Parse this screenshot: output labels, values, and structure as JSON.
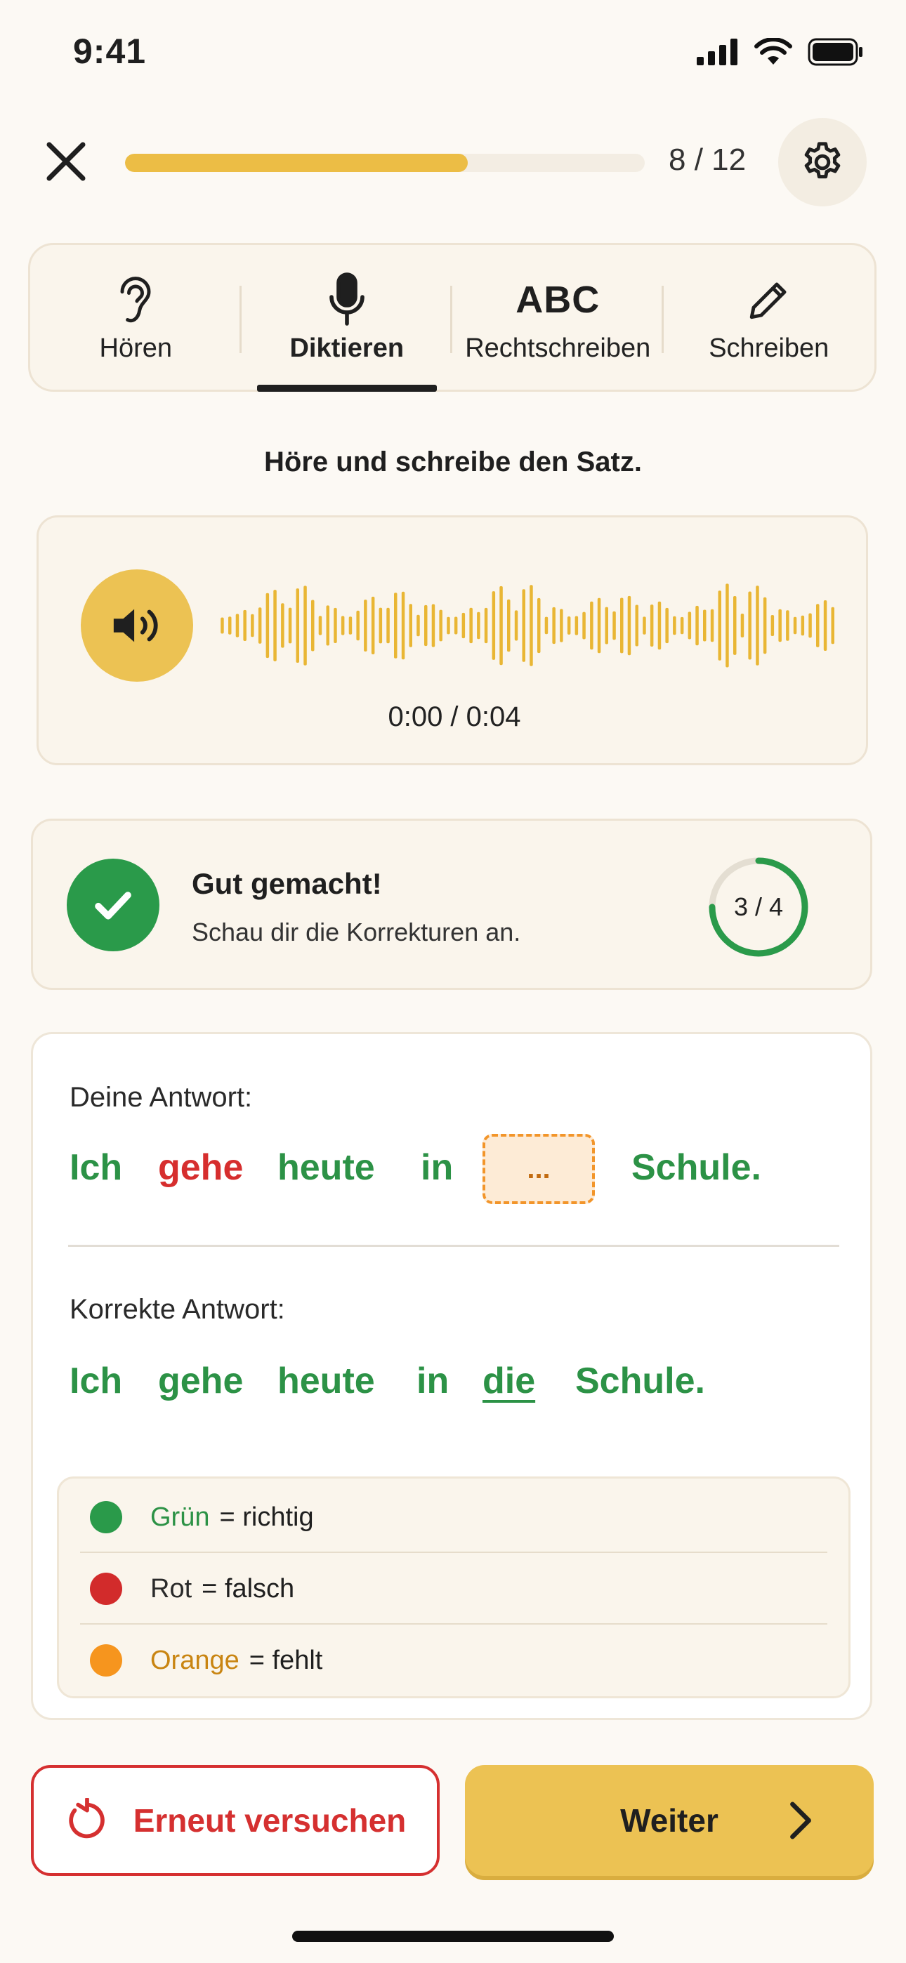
{
  "status_bar": {
    "time": "9:41"
  },
  "header": {
    "progress_text": "8 / 12",
    "progress_fraction": 0.66
  },
  "tabs": [
    {
      "label": "Hören",
      "icon": "ear-icon"
    },
    {
      "label": "Diktieren",
      "icon": "microphone-icon",
      "active": true
    },
    {
      "label": "Rechtschreiben",
      "icon": "abc-icon",
      "glyph": "ABC"
    },
    {
      "label": "Schreiben",
      "icon": "pencil-icon"
    }
  ],
  "instruction": "Höre und schreibe den Satz.",
  "audio": {
    "time": "0:00 / 0:04",
    "icon": "speaker-icon"
  },
  "feedback": {
    "title": "Gut gemacht!",
    "subtitle": "Schau dir die Korrekturen an.",
    "score": "3 / 4",
    "score_fraction": 0.75
  },
  "answer": {
    "user_label": "Deine Antwort:",
    "user_words": [
      "Ich",
      "gehe",
      "heute",
      "in",
      "...",
      "Schule."
    ],
    "correct_label": "Korrekte Antwort:",
    "correct_words": [
      "Ich",
      "gehe",
      "heute",
      "in",
      "die",
      "Schule."
    ]
  },
  "legend": [
    {
      "term": "Grün",
      "desc": "= richtig"
    },
    {
      "term": "Rot",
      "desc": "= falsch"
    },
    {
      "term": "Orange",
      "desc": "= fehlt"
    }
  ],
  "buttons": {
    "retry": "Erneut versuchen",
    "next": "Weiter"
  },
  "colors": {
    "accent": "#ECC253",
    "correct": "#2C9246",
    "wrong": "#D62E2E",
    "missing": "#F2952A"
  }
}
